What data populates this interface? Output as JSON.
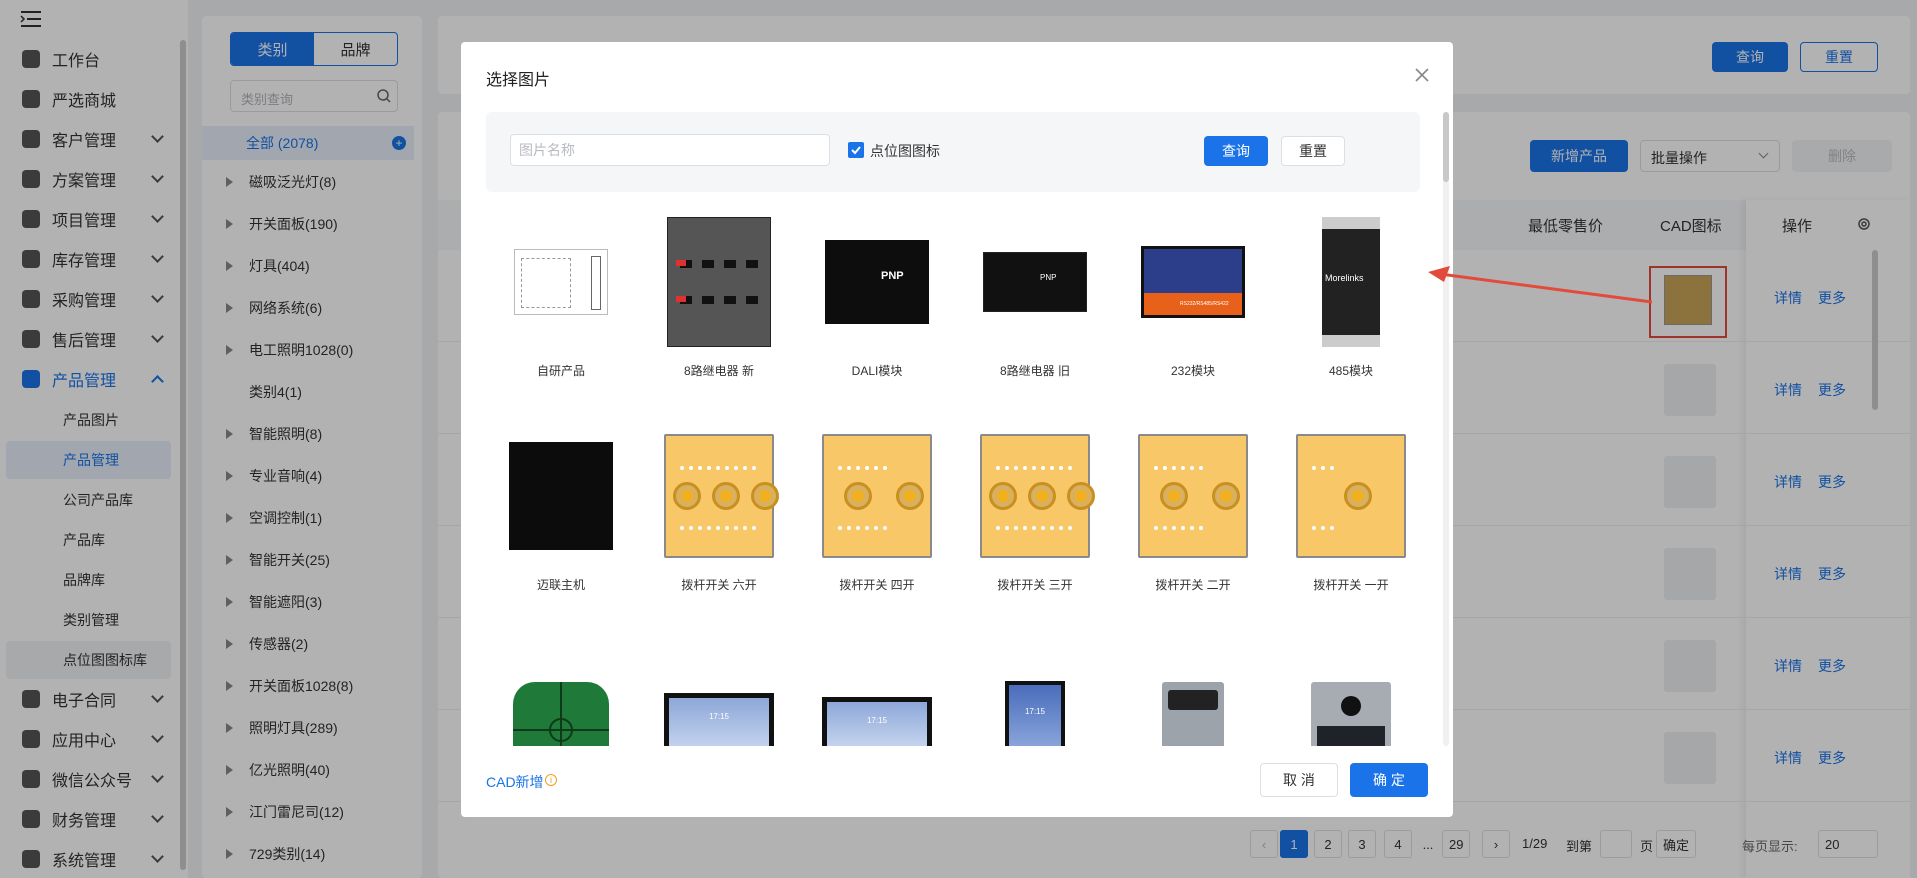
{
  "sidebar": {
    "items": [
      {
        "label": "工作台",
        "icon": "desk-icon",
        "chev": false
      },
      {
        "label": "严选商城",
        "icon": "store-icon",
        "chev": false
      },
      {
        "label": "客户管理",
        "icon": "customer-icon",
        "chev": true
      },
      {
        "label": "方案管理",
        "icon": "plan-icon",
        "chev": true
      },
      {
        "label": "项目管理",
        "icon": "folder-icon",
        "chev": true
      },
      {
        "label": "库存管理",
        "icon": "inventory-icon",
        "chev": true
      },
      {
        "label": "采购管理",
        "icon": "cart-icon",
        "chev": true
      },
      {
        "label": "售后管理",
        "icon": "headset-icon",
        "chev": true
      },
      {
        "label": "产品管理",
        "icon": "product-icon",
        "chev": true,
        "active": true
      }
    ],
    "sub_items": [
      "产品图片",
      "产品管理",
      "公司产品库",
      "产品库",
      "品牌库",
      "类别管理",
      "点位图图标库"
    ],
    "items_after": [
      {
        "label": "电子合同",
        "icon": "contract-icon"
      },
      {
        "label": "应用中心",
        "icon": "apps-icon"
      },
      {
        "label": "微信公众号",
        "icon": "wechat-icon"
      },
      {
        "label": "财务管理",
        "icon": "finance-icon"
      },
      {
        "label": "系统管理",
        "icon": "system-icon"
      }
    ]
  },
  "category": {
    "tab_category": "类别",
    "tab_brand": "品牌",
    "search_placeholder": "类别查询",
    "all": "全部 (2078)",
    "rows": [
      "磁吸泛光灯(8)",
      "开关面板(190)",
      "灯具(404)",
      "网络系统(6)",
      "电工照明1028(0)",
      "类别4(1)",
      "智能照明(8)",
      "专业音响(4)",
      "空调控制(1)",
      "智能开关(25)",
      "智能遮阳(3)",
      "传感器(2)",
      "开关面板1028(8)",
      "照明灯具(289)",
      "亿光照明(40)",
      "江门雷尼司(12)",
      "729类别(14)"
    ]
  },
  "topbar": {
    "query": "查询",
    "reset": "重置"
  },
  "table": {
    "add_product": "新增产品",
    "batch": "批量操作",
    "delete": "删除",
    "col_min_price": "最低零售价",
    "col_cad": "CAD图标",
    "col_ops": "操作",
    "detail": "详情",
    "more": "更多"
  },
  "pagination": {
    "pages": [
      "1",
      "2",
      "3",
      "4",
      "...",
      "29"
    ],
    "current": "1",
    "info": "1/29",
    "goto": "到第",
    "page_unit": "页",
    "confirm": "确定",
    "per_page_label": "每页显示:",
    "per_page": "20"
  },
  "dialog": {
    "title": "选择图片",
    "search_placeholder": "图片名称",
    "checkbox_label": "点位图图标",
    "query": "查询",
    "reset": "重置",
    "images": [
      {
        "caption": "自研产品",
        "kind": "doc"
      },
      {
        "caption": "8路继电器 新",
        "kind": "relay"
      },
      {
        "caption": "DALI模块",
        "kind": "dali"
      },
      {
        "caption": "8路继电器 旧",
        "kind": "relayold"
      },
      {
        "caption": "232模块",
        "kind": "m232"
      },
      {
        "caption": "485模块",
        "kind": "m485"
      },
      {
        "caption": "迈联主机",
        "kind": "host"
      },
      {
        "caption": "拨杆开关 六开",
        "kind": "sw6"
      },
      {
        "caption": "拨杆开关 四开",
        "kind": "sw4"
      },
      {
        "caption": "拨杆开关 三开",
        "kind": "sw3"
      },
      {
        "caption": "拨杆开关 二开",
        "kind": "sw2"
      },
      {
        "caption": "拨杆开关 一开",
        "kind": "sw1"
      },
      {
        "caption": "",
        "kind": "green"
      },
      {
        "caption": "",
        "kind": "screen1"
      },
      {
        "caption": "",
        "kind": "screen2"
      },
      {
        "caption": "",
        "kind": "phone"
      },
      {
        "caption": "",
        "kind": "door1"
      },
      {
        "caption": "",
        "kind": "door2"
      }
    ],
    "image_texts": {
      "pnp": "PNP",
      "morelinks": "Morelinks",
      "time": "17:15",
      "rs": "RS232/RS485/RS422"
    },
    "cad_add": "CAD新增",
    "cancel": "取 消",
    "ok": "确 定"
  }
}
